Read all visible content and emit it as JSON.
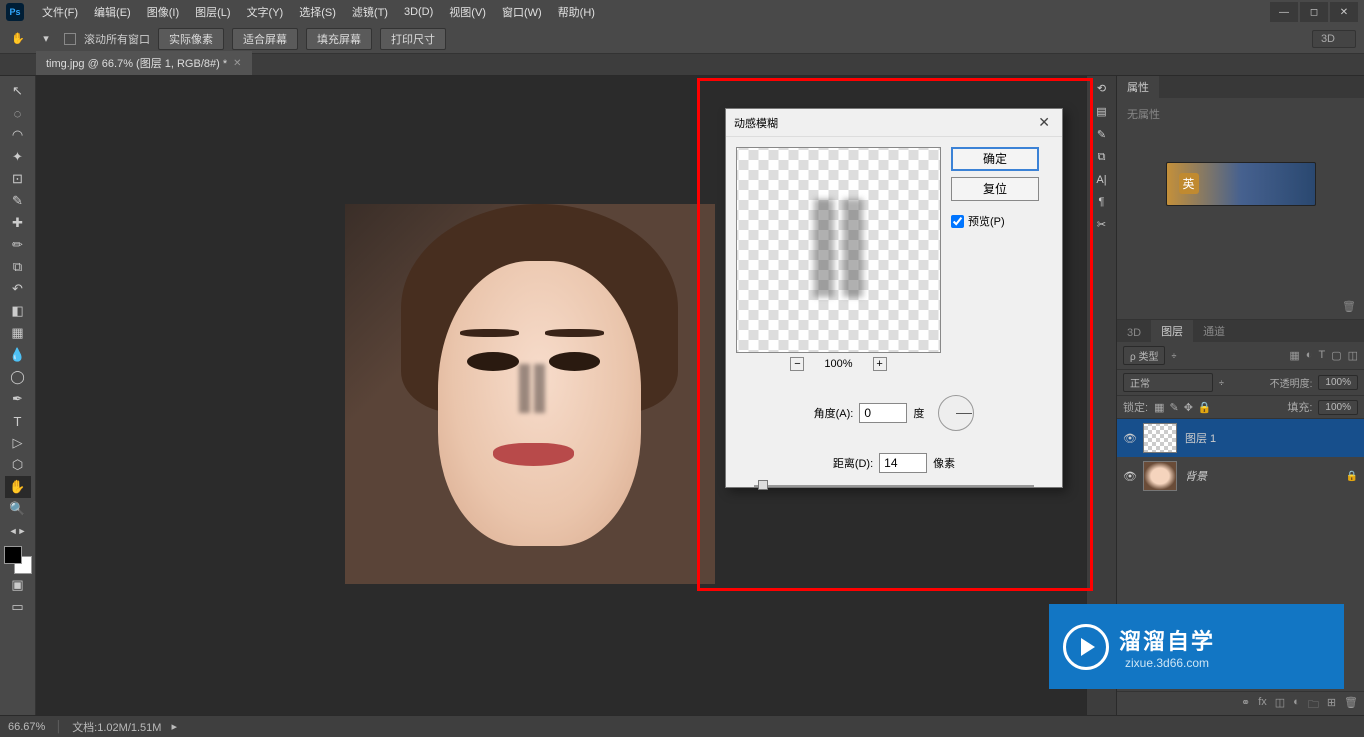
{
  "menu": {
    "file": "文件(F)",
    "edit": "编辑(E)",
    "image": "图像(I)",
    "layer": "图层(L)",
    "type": "文字(Y)",
    "select": "选择(S)",
    "filter": "滤镜(T)",
    "threeD": "3D(D)",
    "view": "视图(V)",
    "window": "窗口(W)",
    "help": "帮助(H)"
  },
  "options": {
    "scrollAll": "滚动所有窗口",
    "actualPixels": "实际像素",
    "fitScreen": "适合屏幕",
    "fillScreen": "填充屏幕",
    "printSize": "打印尺寸",
    "threeD": "3D"
  },
  "doc": {
    "tab": "timg.jpg @ 66.7% (图层 1, RGB/8#) *"
  },
  "dialog": {
    "title": "动感模糊",
    "ok": "确定",
    "reset": "复位",
    "preview": "预览(P)",
    "zoom": "100%",
    "angleLabel": "角度(A):",
    "angleValue": "0",
    "angleUnit": "度",
    "distanceLabel": "距离(D):",
    "distanceValue": "14",
    "distanceUnit": "像素"
  },
  "panels": {
    "properties": "属性",
    "noProps": "无属性",
    "threeDTab": "3D",
    "layersTab": "图层",
    "channelsTab": "通道",
    "typeFilter": "ρ 类型",
    "blendMode": "正常",
    "opacityLabel": "不透明度:",
    "opacityValue": "100%",
    "lockLabel": "锁定:",
    "fillLabel": "填充:",
    "fillValue": "100%",
    "layer1": "图层 1",
    "background": "背景"
  },
  "status": {
    "zoom": "66.67%",
    "doc": "文档:1.02M/1.51M"
  },
  "watermark": {
    "brand": "溜溜自学",
    "url": "zixue.3d66.com"
  }
}
